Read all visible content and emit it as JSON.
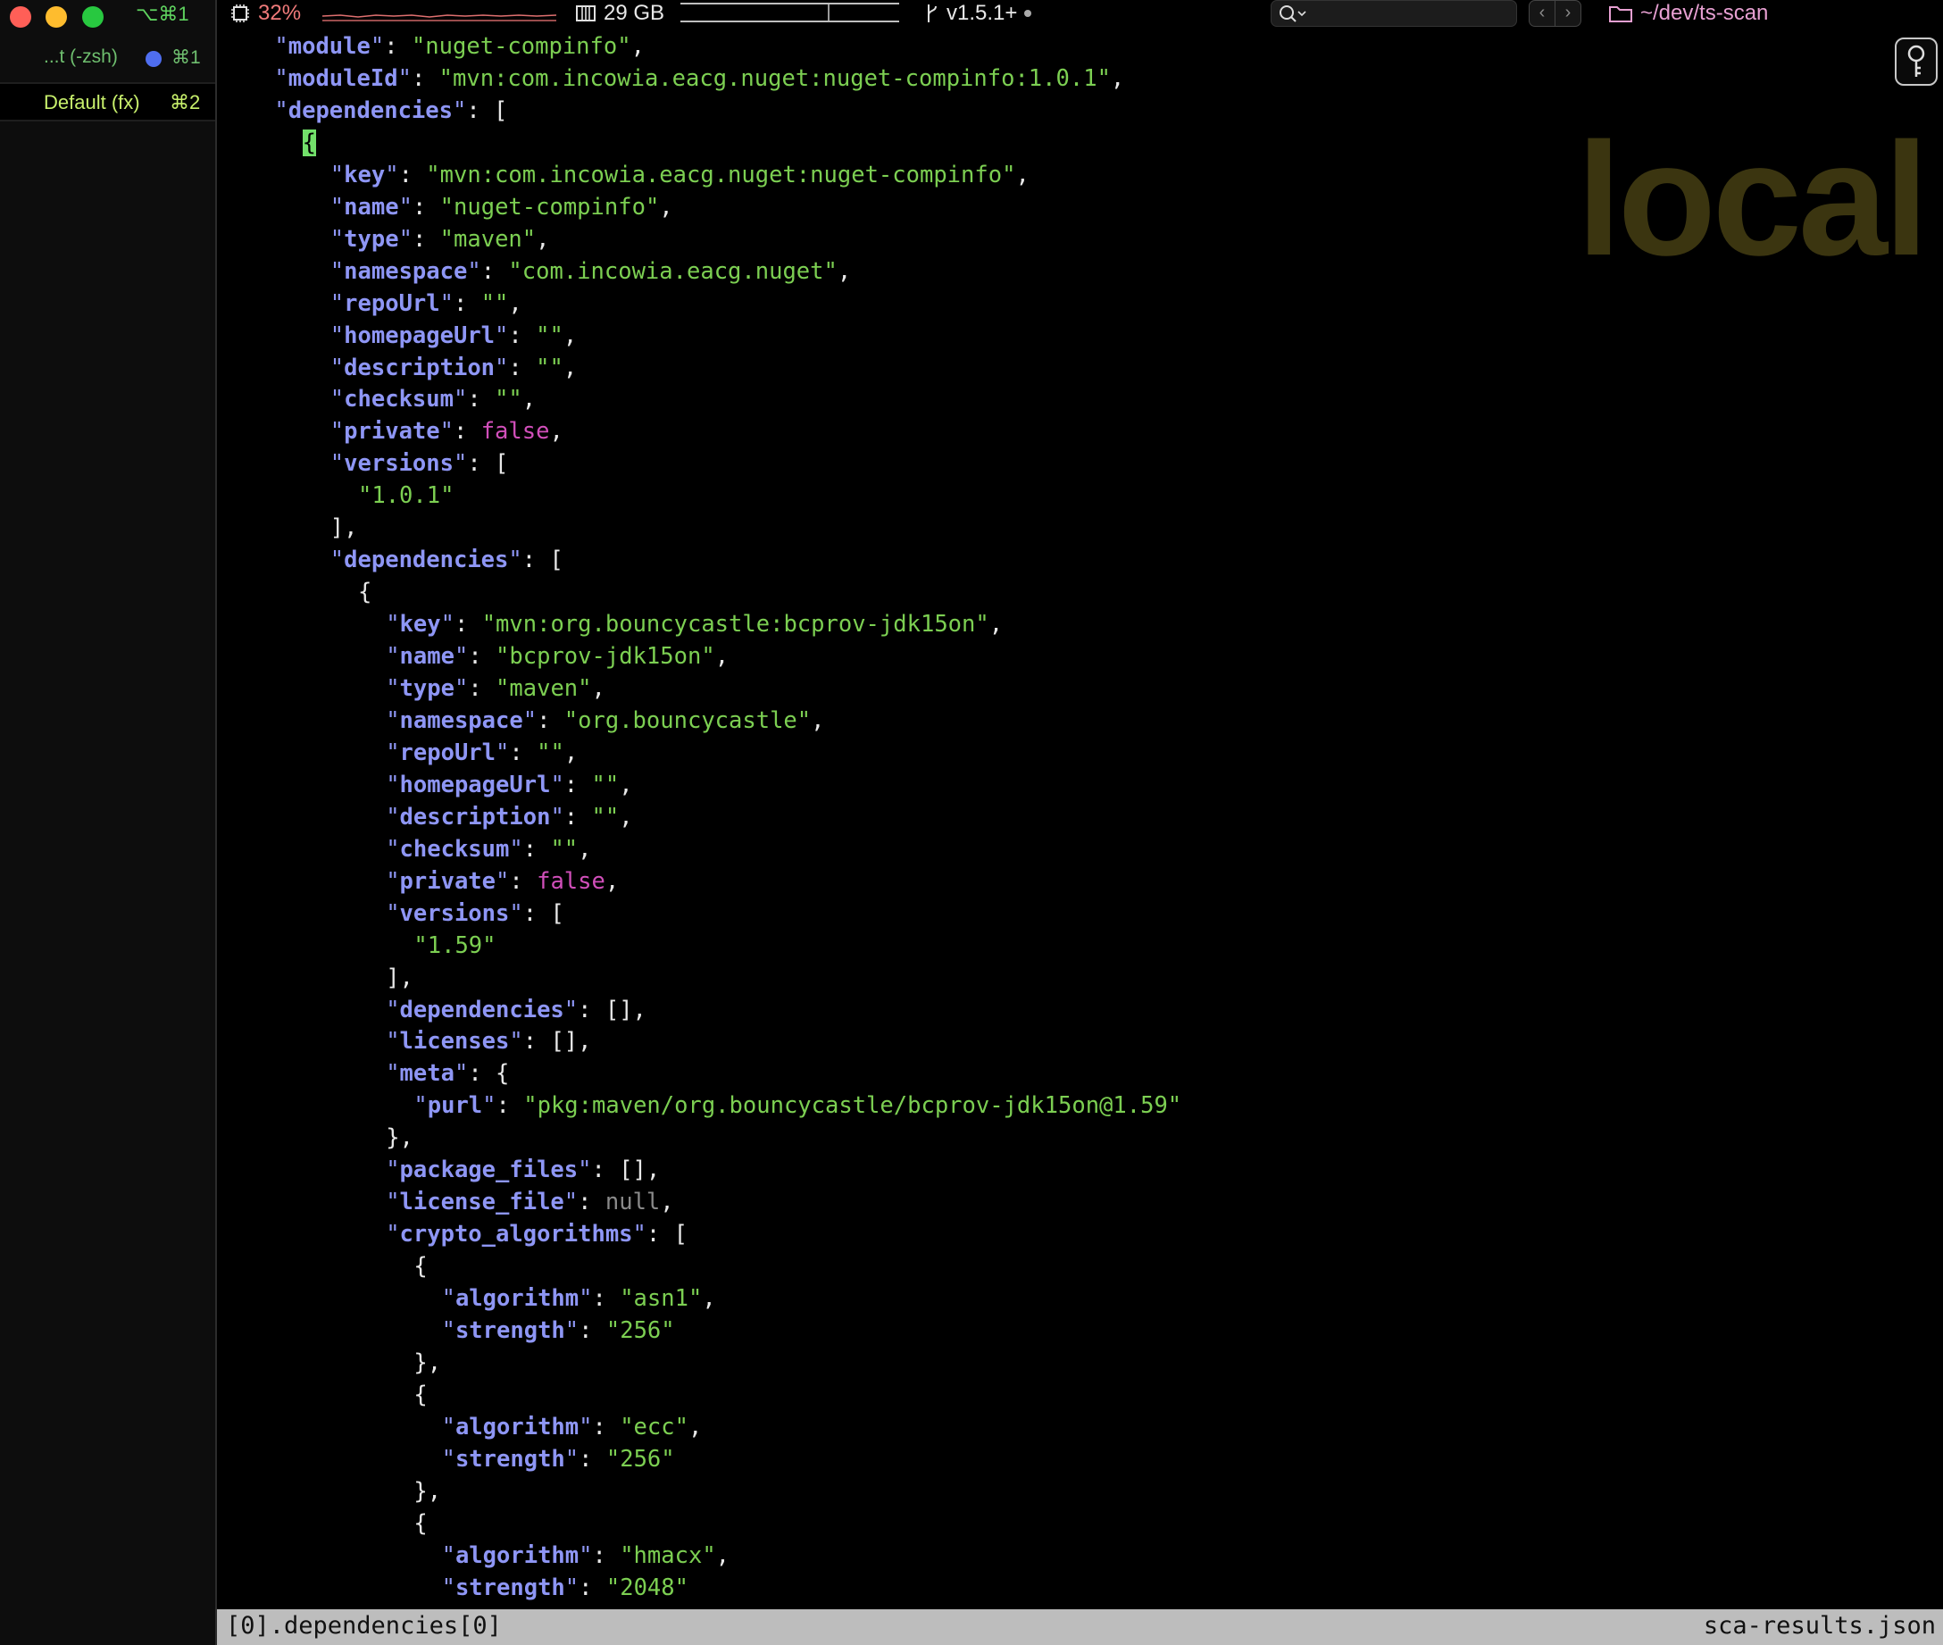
{
  "sidebar": {
    "window_shortcut": "⌥⌘1",
    "tabs": [
      {
        "label": "...t (-zsh)",
        "shortcut": "⌘1"
      },
      {
        "label": "Default (fx)",
        "shortcut": "⌘2"
      }
    ]
  },
  "statusbar": {
    "cpu": "32%",
    "memory": "29 GB",
    "git": "v1.5.1+",
    "cwd": "~/dev/ts-scan"
  },
  "watermark": "local",
  "editor": {
    "lines": [
      {
        "indent": 4,
        "tokens": [
          {
            "t": "key",
            "v": "module"
          },
          {
            "t": "p",
            "v": ": "
          },
          {
            "t": "str",
            "v": "\"nuget-compinfo\""
          },
          {
            "t": "p",
            "v": ","
          }
        ]
      },
      {
        "indent": 4,
        "tokens": [
          {
            "t": "key",
            "v": "moduleId"
          },
          {
            "t": "p",
            "v": ": "
          },
          {
            "t": "str",
            "v": "\"mvn:com.incowia.eacg.nuget:nuget-compinfo:1.0.1\""
          },
          {
            "t": "p",
            "v": ","
          }
        ]
      },
      {
        "indent": 4,
        "tokens": [
          {
            "t": "key",
            "v": "dependencies"
          },
          {
            "t": "p",
            "v": ": ["
          }
        ]
      },
      {
        "indent": 6,
        "tokens": [
          {
            "t": "cursor",
            "v": "{"
          }
        ]
      },
      {
        "indent": 8,
        "tokens": [
          {
            "t": "key",
            "v": "key"
          },
          {
            "t": "p",
            "v": ": "
          },
          {
            "t": "str",
            "v": "\"mvn:com.incowia.eacg.nuget:nuget-compinfo\""
          },
          {
            "t": "p",
            "v": ","
          }
        ]
      },
      {
        "indent": 8,
        "tokens": [
          {
            "t": "key",
            "v": "name"
          },
          {
            "t": "p",
            "v": ": "
          },
          {
            "t": "str",
            "v": "\"nuget-compinfo\""
          },
          {
            "t": "p",
            "v": ","
          }
        ]
      },
      {
        "indent": 8,
        "tokens": [
          {
            "t": "key",
            "v": "type"
          },
          {
            "t": "p",
            "v": ": "
          },
          {
            "t": "str",
            "v": "\"maven\""
          },
          {
            "t": "p",
            "v": ","
          }
        ]
      },
      {
        "indent": 8,
        "tokens": [
          {
            "t": "key",
            "v": "namespace"
          },
          {
            "t": "p",
            "v": ": "
          },
          {
            "t": "str",
            "v": "\"com.incowia.eacg.nuget\""
          },
          {
            "t": "p",
            "v": ","
          }
        ]
      },
      {
        "indent": 8,
        "tokens": [
          {
            "t": "key",
            "v": "repoUrl"
          },
          {
            "t": "p",
            "v": ": "
          },
          {
            "t": "str",
            "v": "\"\""
          },
          {
            "t": "p",
            "v": ","
          }
        ]
      },
      {
        "indent": 8,
        "tokens": [
          {
            "t": "key",
            "v": "homepageUrl"
          },
          {
            "t": "p",
            "v": ": "
          },
          {
            "t": "str",
            "v": "\"\""
          },
          {
            "t": "p",
            "v": ","
          }
        ]
      },
      {
        "indent": 8,
        "tokens": [
          {
            "t": "key",
            "v": "description"
          },
          {
            "t": "p",
            "v": ": "
          },
          {
            "t": "str",
            "v": "\"\""
          },
          {
            "t": "p",
            "v": ","
          }
        ]
      },
      {
        "indent": 8,
        "tokens": [
          {
            "t": "key",
            "v": "checksum"
          },
          {
            "t": "p",
            "v": ": "
          },
          {
            "t": "str",
            "v": "\"\""
          },
          {
            "t": "p",
            "v": ","
          }
        ]
      },
      {
        "indent": 8,
        "tokens": [
          {
            "t": "key",
            "v": "private"
          },
          {
            "t": "p",
            "v": ": "
          },
          {
            "t": "kw",
            "v": "false"
          },
          {
            "t": "p",
            "v": ","
          }
        ]
      },
      {
        "indent": 8,
        "tokens": [
          {
            "t": "key",
            "v": "versions"
          },
          {
            "t": "p",
            "v": ": ["
          }
        ]
      },
      {
        "indent": 10,
        "tokens": [
          {
            "t": "str",
            "v": "\"1.0.1\""
          }
        ]
      },
      {
        "indent": 8,
        "tokens": [
          {
            "t": "p",
            "v": "],"
          }
        ]
      },
      {
        "indent": 8,
        "tokens": [
          {
            "t": "key",
            "v": "dependencies"
          },
          {
            "t": "p",
            "v": ": ["
          }
        ]
      },
      {
        "indent": 10,
        "tokens": [
          {
            "t": "p",
            "v": "{"
          }
        ]
      },
      {
        "indent": 12,
        "tokens": [
          {
            "t": "key",
            "v": "key"
          },
          {
            "t": "p",
            "v": ": "
          },
          {
            "t": "str",
            "v": "\"mvn:org.bouncycastle:bcprov-jdk15on\""
          },
          {
            "t": "p",
            "v": ","
          }
        ]
      },
      {
        "indent": 12,
        "tokens": [
          {
            "t": "key",
            "v": "name"
          },
          {
            "t": "p",
            "v": ": "
          },
          {
            "t": "str",
            "v": "\"bcprov-jdk15on\""
          },
          {
            "t": "p",
            "v": ","
          }
        ]
      },
      {
        "indent": 12,
        "tokens": [
          {
            "t": "key",
            "v": "type"
          },
          {
            "t": "p",
            "v": ": "
          },
          {
            "t": "str",
            "v": "\"maven\""
          },
          {
            "t": "p",
            "v": ","
          }
        ]
      },
      {
        "indent": 12,
        "tokens": [
          {
            "t": "key",
            "v": "namespace"
          },
          {
            "t": "p",
            "v": ": "
          },
          {
            "t": "str",
            "v": "\"org.bouncycastle\""
          },
          {
            "t": "p",
            "v": ","
          }
        ]
      },
      {
        "indent": 12,
        "tokens": [
          {
            "t": "key",
            "v": "repoUrl"
          },
          {
            "t": "p",
            "v": ": "
          },
          {
            "t": "str",
            "v": "\"\""
          },
          {
            "t": "p",
            "v": ","
          }
        ]
      },
      {
        "indent": 12,
        "tokens": [
          {
            "t": "key",
            "v": "homepageUrl"
          },
          {
            "t": "p",
            "v": ": "
          },
          {
            "t": "str",
            "v": "\"\""
          },
          {
            "t": "p",
            "v": ","
          }
        ]
      },
      {
        "indent": 12,
        "tokens": [
          {
            "t": "key",
            "v": "description"
          },
          {
            "t": "p",
            "v": ": "
          },
          {
            "t": "str",
            "v": "\"\""
          },
          {
            "t": "p",
            "v": ","
          }
        ]
      },
      {
        "indent": 12,
        "tokens": [
          {
            "t": "key",
            "v": "checksum"
          },
          {
            "t": "p",
            "v": ": "
          },
          {
            "t": "str",
            "v": "\"\""
          },
          {
            "t": "p",
            "v": ","
          }
        ]
      },
      {
        "indent": 12,
        "tokens": [
          {
            "t": "key",
            "v": "private"
          },
          {
            "t": "p",
            "v": ": "
          },
          {
            "t": "kw",
            "v": "false"
          },
          {
            "t": "p",
            "v": ","
          }
        ]
      },
      {
        "indent": 12,
        "tokens": [
          {
            "t": "key",
            "v": "versions"
          },
          {
            "t": "p",
            "v": ": ["
          }
        ]
      },
      {
        "indent": 14,
        "tokens": [
          {
            "t": "str",
            "v": "\"1.59\""
          }
        ]
      },
      {
        "indent": 12,
        "tokens": [
          {
            "t": "p",
            "v": "],"
          }
        ]
      },
      {
        "indent": 12,
        "tokens": [
          {
            "t": "key",
            "v": "dependencies"
          },
          {
            "t": "p",
            "v": ": [],"
          }
        ]
      },
      {
        "indent": 12,
        "tokens": [
          {
            "t": "key",
            "v": "licenses"
          },
          {
            "t": "p",
            "v": ": [],"
          }
        ]
      },
      {
        "indent": 12,
        "tokens": [
          {
            "t": "key",
            "v": "meta"
          },
          {
            "t": "p",
            "v": ": {"
          }
        ]
      },
      {
        "indent": 14,
        "tokens": [
          {
            "t": "key",
            "v": "purl"
          },
          {
            "t": "p",
            "v": ": "
          },
          {
            "t": "str",
            "v": "\"pkg:maven/org.bouncycastle/bcprov-jdk15on@1.59\""
          }
        ]
      },
      {
        "indent": 12,
        "tokens": [
          {
            "t": "p",
            "v": "},"
          }
        ]
      },
      {
        "indent": 12,
        "tokens": [
          {
            "t": "key",
            "v": "package_files"
          },
          {
            "t": "p",
            "v": ": [],"
          }
        ]
      },
      {
        "indent": 12,
        "tokens": [
          {
            "t": "key",
            "v": "license_file"
          },
          {
            "t": "p",
            "v": ": "
          },
          {
            "t": "null",
            "v": "null"
          },
          {
            "t": "p",
            "v": ","
          }
        ]
      },
      {
        "indent": 12,
        "tokens": [
          {
            "t": "key",
            "v": "crypto_algorithms"
          },
          {
            "t": "p",
            "v": ": ["
          }
        ]
      },
      {
        "indent": 14,
        "tokens": [
          {
            "t": "p",
            "v": "{"
          }
        ]
      },
      {
        "indent": 16,
        "tokens": [
          {
            "t": "key",
            "v": "algorithm"
          },
          {
            "t": "p",
            "v": ": "
          },
          {
            "t": "str",
            "v": "\"asn1\""
          },
          {
            "t": "p",
            "v": ","
          }
        ]
      },
      {
        "indent": 16,
        "tokens": [
          {
            "t": "key",
            "v": "strength"
          },
          {
            "t": "p",
            "v": ": "
          },
          {
            "t": "str",
            "v": "\"256\""
          }
        ]
      },
      {
        "indent": 14,
        "tokens": [
          {
            "t": "p",
            "v": "},"
          }
        ]
      },
      {
        "indent": 14,
        "tokens": [
          {
            "t": "p",
            "v": "{"
          }
        ]
      },
      {
        "indent": 16,
        "tokens": [
          {
            "t": "key",
            "v": "algorithm"
          },
          {
            "t": "p",
            "v": ": "
          },
          {
            "t": "str",
            "v": "\"ecc\""
          },
          {
            "t": "p",
            "v": ","
          }
        ]
      },
      {
        "indent": 16,
        "tokens": [
          {
            "t": "key",
            "v": "strength"
          },
          {
            "t": "p",
            "v": ": "
          },
          {
            "t": "str",
            "v": "\"256\""
          }
        ]
      },
      {
        "indent": 14,
        "tokens": [
          {
            "t": "p",
            "v": "},"
          }
        ]
      },
      {
        "indent": 14,
        "tokens": [
          {
            "t": "p",
            "v": "{"
          }
        ]
      },
      {
        "indent": 16,
        "tokens": [
          {
            "t": "key",
            "v": "algorithm"
          },
          {
            "t": "p",
            "v": ": "
          },
          {
            "t": "str",
            "v": "\"hmacx\""
          },
          {
            "t": "p",
            "v": ","
          }
        ]
      },
      {
        "indent": 16,
        "tokens": [
          {
            "t": "key",
            "v": "strength"
          },
          {
            "t": "p",
            "v": ": "
          },
          {
            "t": "str",
            "v": "\"2048\""
          }
        ]
      }
    ]
  },
  "statusline": {
    "path": "[0].dependencies[0]",
    "file": "sca-results.json"
  },
  "icons": {
    "cpu": "cpu-chip-icon",
    "memory": "memory-icon",
    "git": "git-branch-icon",
    "search": "search-icon",
    "folder": "folder-icon",
    "side": "keyhole-icon"
  }
}
